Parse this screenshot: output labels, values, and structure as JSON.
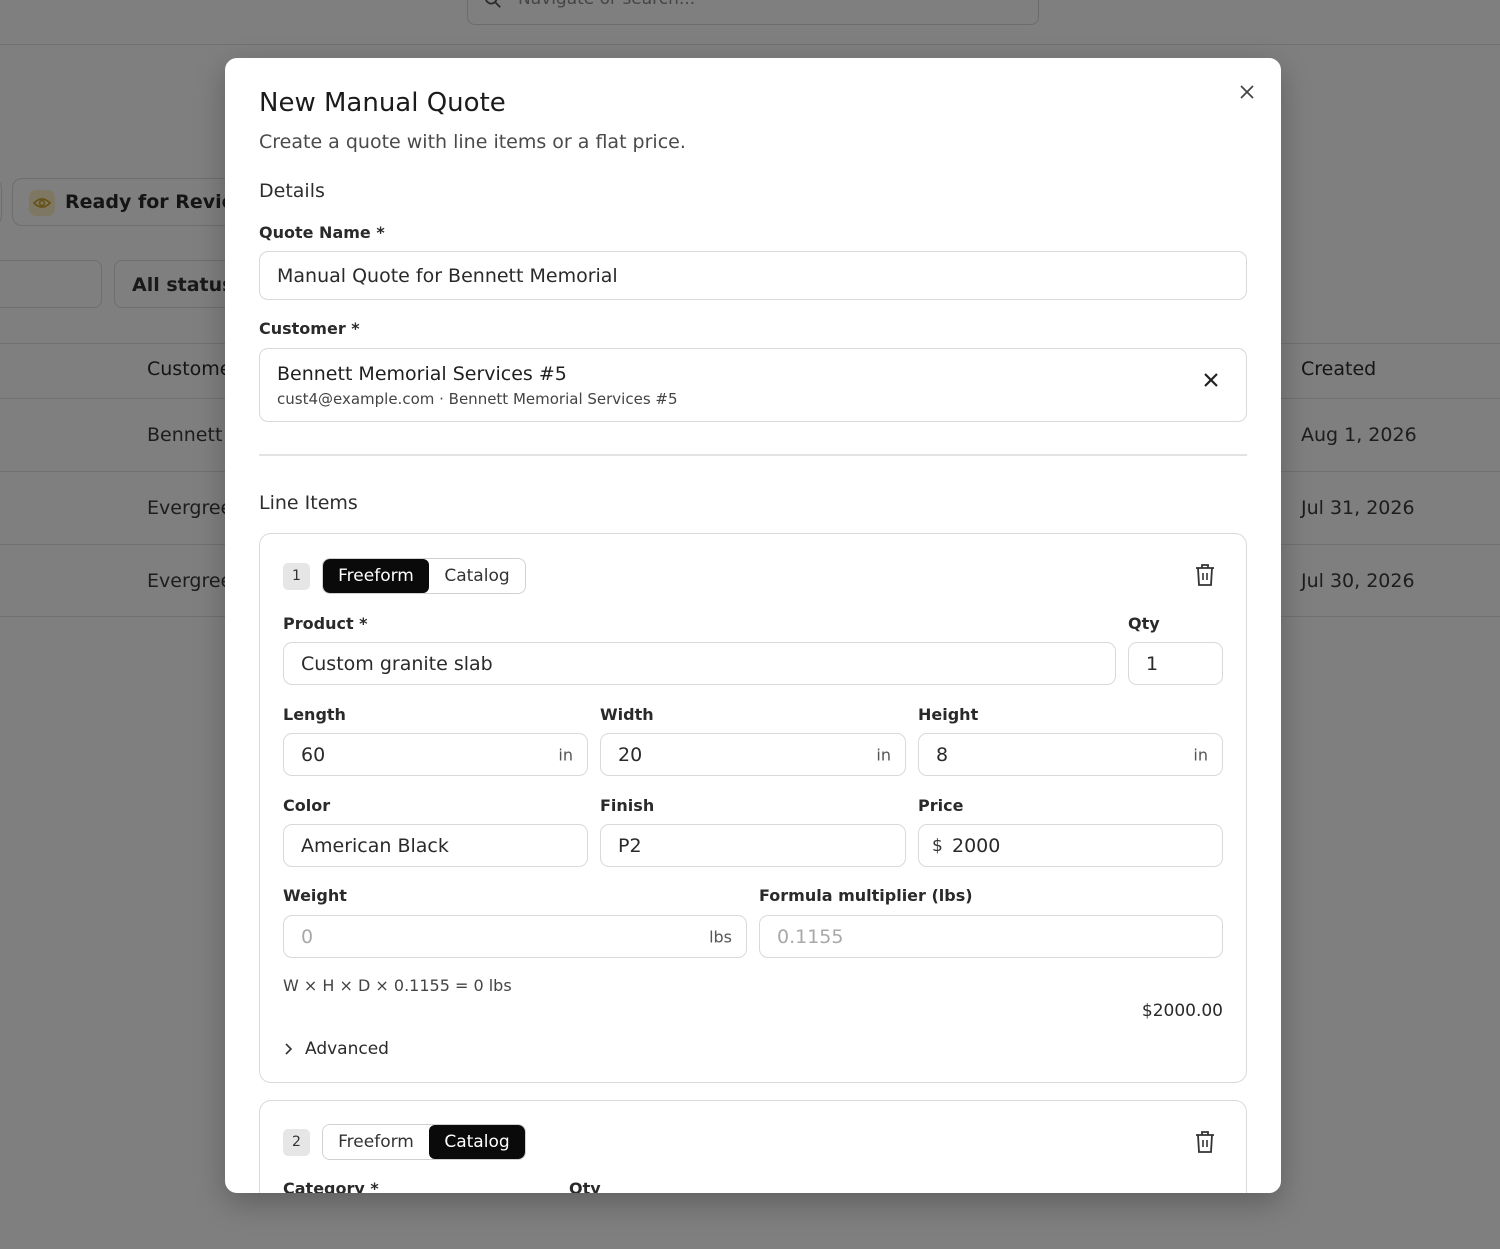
{
  "background": {
    "search_placeholder": "Navigate or search...",
    "status_pill_label": "Ready for Review",
    "status_filter_label": "All statuses",
    "table_headers": {
      "customer": "Customer",
      "created": "Created"
    },
    "rows": [
      {
        "customer": "Bennett",
        "created": "Aug 1, 2026"
      },
      {
        "customer": "Evergreen",
        "created": "Jul 31, 2026"
      },
      {
        "customer": "Evergreen",
        "created": "Jul 30, 2026"
      }
    ]
  },
  "modal": {
    "title": "New Manual Quote",
    "subtitle": "Create a quote with line items or a flat price.",
    "details_heading": "Details",
    "quote_name_label": "Quote Name *",
    "quote_name_value": "Manual Quote for Bennett Memorial",
    "customer_label": "Customer *",
    "customer": {
      "name": "Bennett Memorial Services #5",
      "meta": "cust4@example.com · Bennett Memorial Services #5"
    },
    "line_items_heading": "Line Items",
    "line_items": [
      {
        "number": "1",
        "mode_options": [
          "Freeform",
          "Catalog"
        ],
        "active_mode": "Freeform",
        "product_label": "Product *",
        "product_value": "Custom granite slab",
        "qty_label": "Qty",
        "qty_value": "1",
        "length_label": "Length",
        "length_value": "60",
        "length_unit": "in",
        "width_label": "Width",
        "width_value": "20",
        "width_unit": "in",
        "height_label": "Height",
        "height_value": "8",
        "height_unit": "in",
        "color_label": "Color",
        "color_value": "American Black",
        "finish_label": "Finish",
        "finish_value": "P2",
        "price_label": "Price",
        "price_prefix": "$",
        "price_value": "2000",
        "weight_label": "Weight",
        "weight_placeholder": "0",
        "weight_unit": "lbs",
        "multiplier_label": "Formula multiplier (lbs)",
        "multiplier_placeholder": "0.1155",
        "formula_text": "W × H × D × 0.1155 = 0 lbs",
        "line_total": "$2000.00",
        "advanced_label": "Advanced"
      },
      {
        "number": "2",
        "mode_options": [
          "Freeform",
          "Catalog"
        ],
        "active_mode": "Catalog",
        "category_label": "Category *",
        "qty_label": "Qty"
      }
    ]
  },
  "colors": {
    "overlay": "#808080",
    "segment_active": "#0a0a0a",
    "badge_bg": "#e6e6e6",
    "eye_badge": "#fdf1c6"
  },
  "icons": [
    "search-icon",
    "eye-icon",
    "close-icon",
    "clear-icon",
    "trash-icon",
    "chevron-right-icon"
  ]
}
